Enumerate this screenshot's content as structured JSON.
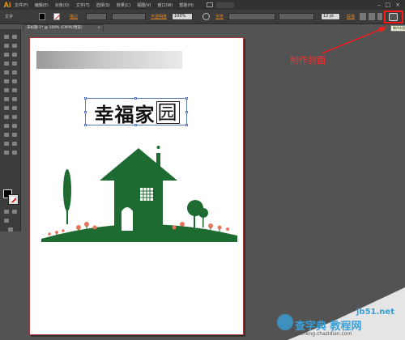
{
  "app": {
    "logo": "Ai"
  },
  "menu": [
    "文件(F)",
    "编辑(E)",
    "对象(O)",
    "文字(T)",
    "选择(S)",
    "效果(C)",
    "视图(V)",
    "窗口(W)",
    "帮助(H)"
  ],
  "control_bar": {
    "mode_label": "文字",
    "stroke_label": "描边",
    "opacity_label": "不透明度",
    "opacity_value": "100%",
    "char_label": "字符",
    "font_size_value": "12 pt",
    "para_label": "段落",
    "cover_tooltip": "制作封面"
  },
  "tab": {
    "title": "未标题-1* @ 100% (CMYK/预览)",
    "close": "×"
  },
  "canvas": {
    "title_main": "幸福家",
    "title_last": "园"
  },
  "annotation": {
    "label": "制作封面",
    "color": "#ff1a1a"
  },
  "watermark": {
    "site": "jb51.net",
    "cn": "查字典 教程网",
    "url": "jiaocheng.chazidian.com"
  },
  "colors": {
    "house_green": "#1e6b32",
    "flower_orange": "#e8745a"
  }
}
